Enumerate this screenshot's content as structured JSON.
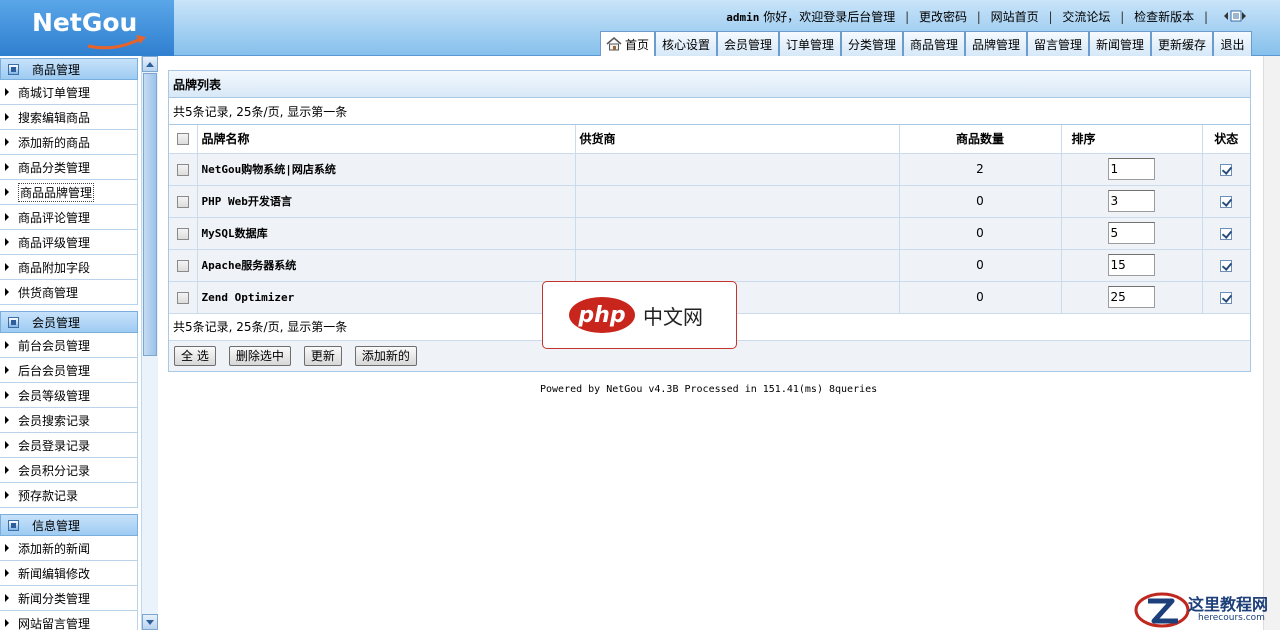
{
  "header": {
    "logo": "NetGou",
    "user": "admin",
    "greeting": "你好，欢迎登录后台管理",
    "links": [
      "更改密码",
      "网站首页",
      "交流论坛",
      "检查新版本"
    ],
    "tabs": [
      "首页",
      "核心设置",
      "会员管理",
      "订单管理",
      "分类管理",
      "商品管理",
      "品牌管理",
      "留言管理",
      "新闻管理",
      "更新缓存",
      "退出"
    ]
  },
  "sidebar": {
    "sections": [
      {
        "title": "商品管理",
        "items": [
          "商城订单管理",
          "搜索编辑商品",
          "添加新的商品",
          "商品分类管理",
          "商品品牌管理",
          "商品评论管理",
          "商品评级管理",
          "商品附加字段",
          "供货商管理"
        ]
      },
      {
        "title": "会员管理",
        "items": [
          "前台会员管理",
          "后台会员管理",
          "会员等级管理",
          "会员搜索记录",
          "会员登录记录",
          "会员积分记录",
          "预存款记录"
        ]
      },
      {
        "title": "信息管理",
        "items": [
          "添加新的新闻",
          "新闻编辑修改",
          "新闻分类管理",
          "网站留言管理"
        ]
      }
    ]
  },
  "panel": {
    "title": "品牌列表",
    "summary": "共5条记录, 25条/页, 显示第一条",
    "columns": [
      "品牌名称",
      "供货商",
      "商品数量",
      "排序",
      "状态"
    ],
    "rows": [
      {
        "name": "NetGou购物系统|网店系统",
        "supplier": "",
        "count": "2",
        "sort": "1"
      },
      {
        "name": "PHP Web开发语言",
        "supplier": "",
        "count": "0",
        "sort": "3"
      },
      {
        "name": "MySQL数据库",
        "supplier": "",
        "count": "0",
        "sort": "5"
      },
      {
        "name": "Apache服务器系统",
        "supplier": "",
        "count": "0",
        "sort": "15"
      },
      {
        "name": "Zend Optimizer",
        "supplier": "",
        "count": "0",
        "sort": "25"
      }
    ],
    "buttons": {
      "select_all": "全 选",
      "delete_selected": "删除选中",
      "update": "更新",
      "add_new": "添加新的"
    }
  },
  "footer": "Powered by NetGou v4.3B Processed in 151.41(ms) 8queries",
  "watermarks": {
    "php_logo": "php",
    "php_text": "中文网",
    "here_text": "这里教程网",
    "here_url": "herecours.com"
  }
}
